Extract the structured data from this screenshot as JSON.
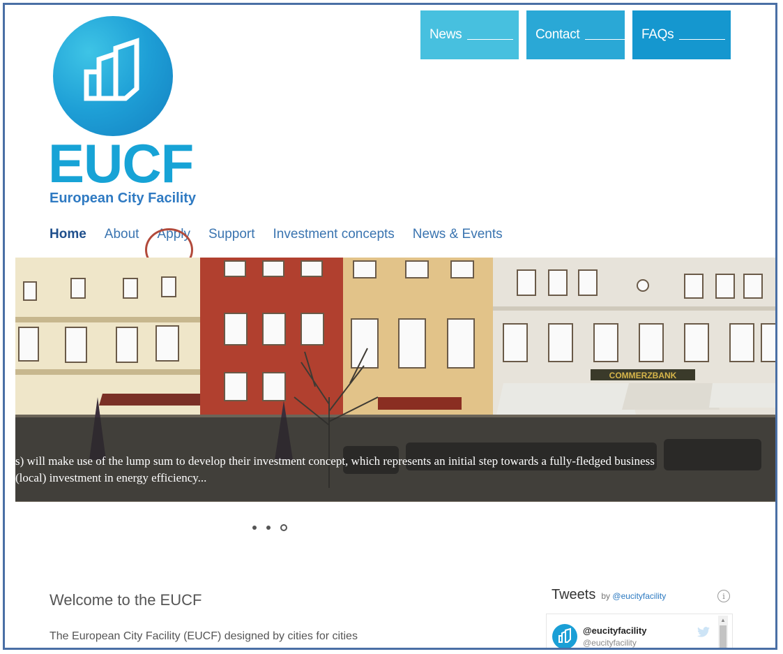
{
  "top_nav": {
    "tabs": [
      {
        "label": "News",
        "color": "#47c0df"
      },
      {
        "label": "Contact",
        "color": "#2aa8d6"
      },
      {
        "label": "FAQs",
        "color": "#1597cf"
      }
    ]
  },
  "logo": {
    "wordmark": "EUCF",
    "subtitle": "European City Facility"
  },
  "main_nav": {
    "items": [
      {
        "label": "Home",
        "active": true
      },
      {
        "label": "About"
      },
      {
        "label": "Apply"
      },
      {
        "label": "Support"
      },
      {
        "label": "Investment concepts"
      },
      {
        "label": "News & Events"
      }
    ]
  },
  "hero": {
    "caption_line1": "s) will make use of the lump sum to develop their investment concept, which represents an initial step towards a fully-fledged business",
    "caption_line2": " (local) investment in energy efficiency...",
    "slides_total": 3,
    "active_slide": 3
  },
  "welcome": {
    "title": "Welcome to the EUCF",
    "text": "The European City Facility (EUCF) designed by cities for cities"
  },
  "tweets": {
    "title": "Tweets",
    "by_prefix": "by",
    "by_handle": "@eucityfacility",
    "info_glyph": "i",
    "tweet_name": "@eucityfacility",
    "tweet_handle": "@eucityfacility"
  },
  "colors": {
    "accent_dark": "#1f4f8c",
    "accent_link": "#3a74b0",
    "annotation_circle": "#b24a3b",
    "frame_border": "#4a6fa5"
  }
}
